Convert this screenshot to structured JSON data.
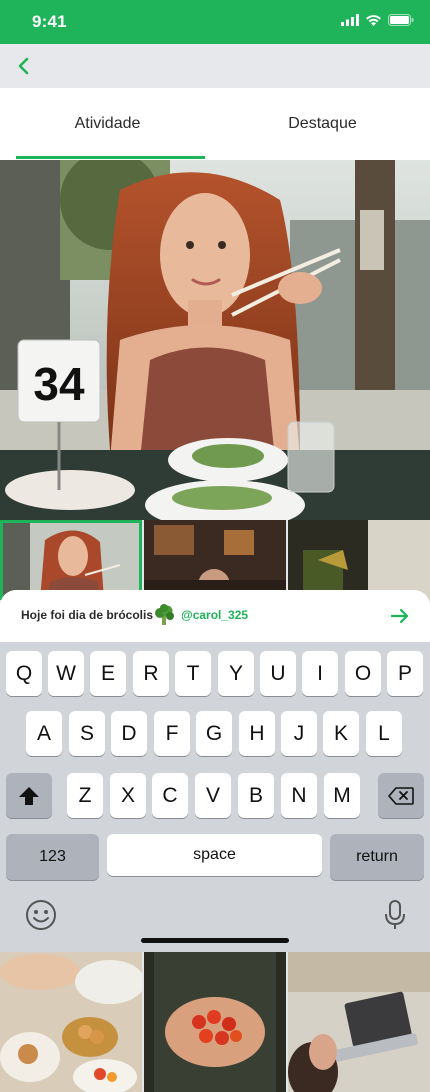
{
  "status": {
    "time": "9:41"
  },
  "tabs": [
    {
      "label": "Atividade"
    },
    {
      "label": "Destaque"
    }
  ],
  "main_photo": {
    "table_number": "34"
  },
  "caption": {
    "text": "Hoje foi dia de brócolis",
    "emoji": "broccoli-icon",
    "user": "@carol_325"
  },
  "keyboard": {
    "row1": [
      "Q",
      "W",
      "E",
      "R",
      "T",
      "Y",
      "U",
      "I",
      "O",
      "P"
    ],
    "row2": [
      "A",
      "S",
      "D",
      "F",
      "G",
      "H",
      "J",
      "K",
      "L"
    ],
    "row3": [
      "Z",
      "X",
      "C",
      "V",
      "B",
      "N",
      "M"
    ],
    "numbers": "123",
    "space": "space",
    "return": "return"
  },
  "colors": {
    "accent": "#1fb35a",
    "keyboard_bg": "#d1d4d9",
    "nav_bg": "#e6e8ec"
  }
}
